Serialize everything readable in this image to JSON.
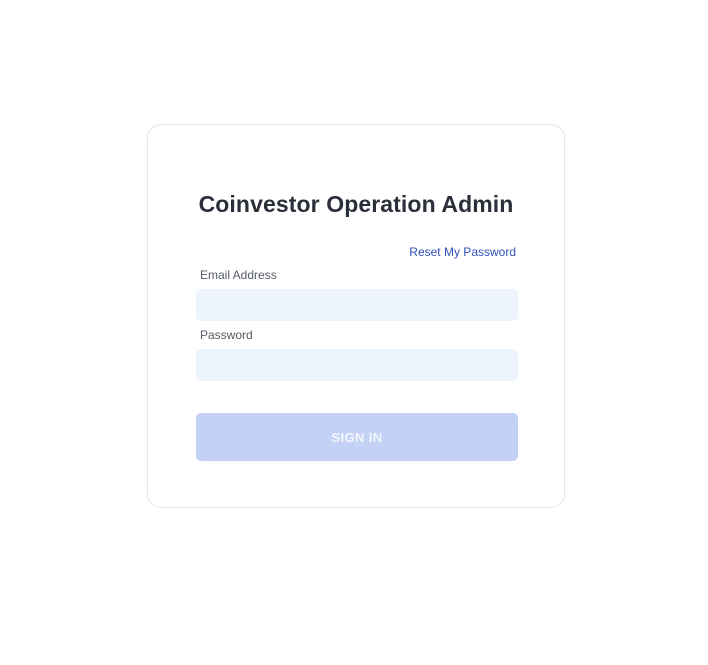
{
  "login": {
    "title": "Coinvestor Operation Admin",
    "reset_link": "Reset My Password",
    "email_label": "Email Address",
    "email_value": "",
    "password_label": "Password",
    "password_value": "",
    "signin_label": "SIGN IN"
  },
  "colors": {
    "background": "#ffffff",
    "card_border": "#e2e5ea",
    "title": "#2a2f3a",
    "link": "#3150b8",
    "input_fill": "#eef4fd",
    "button_disabled": "#c3d1f6"
  }
}
